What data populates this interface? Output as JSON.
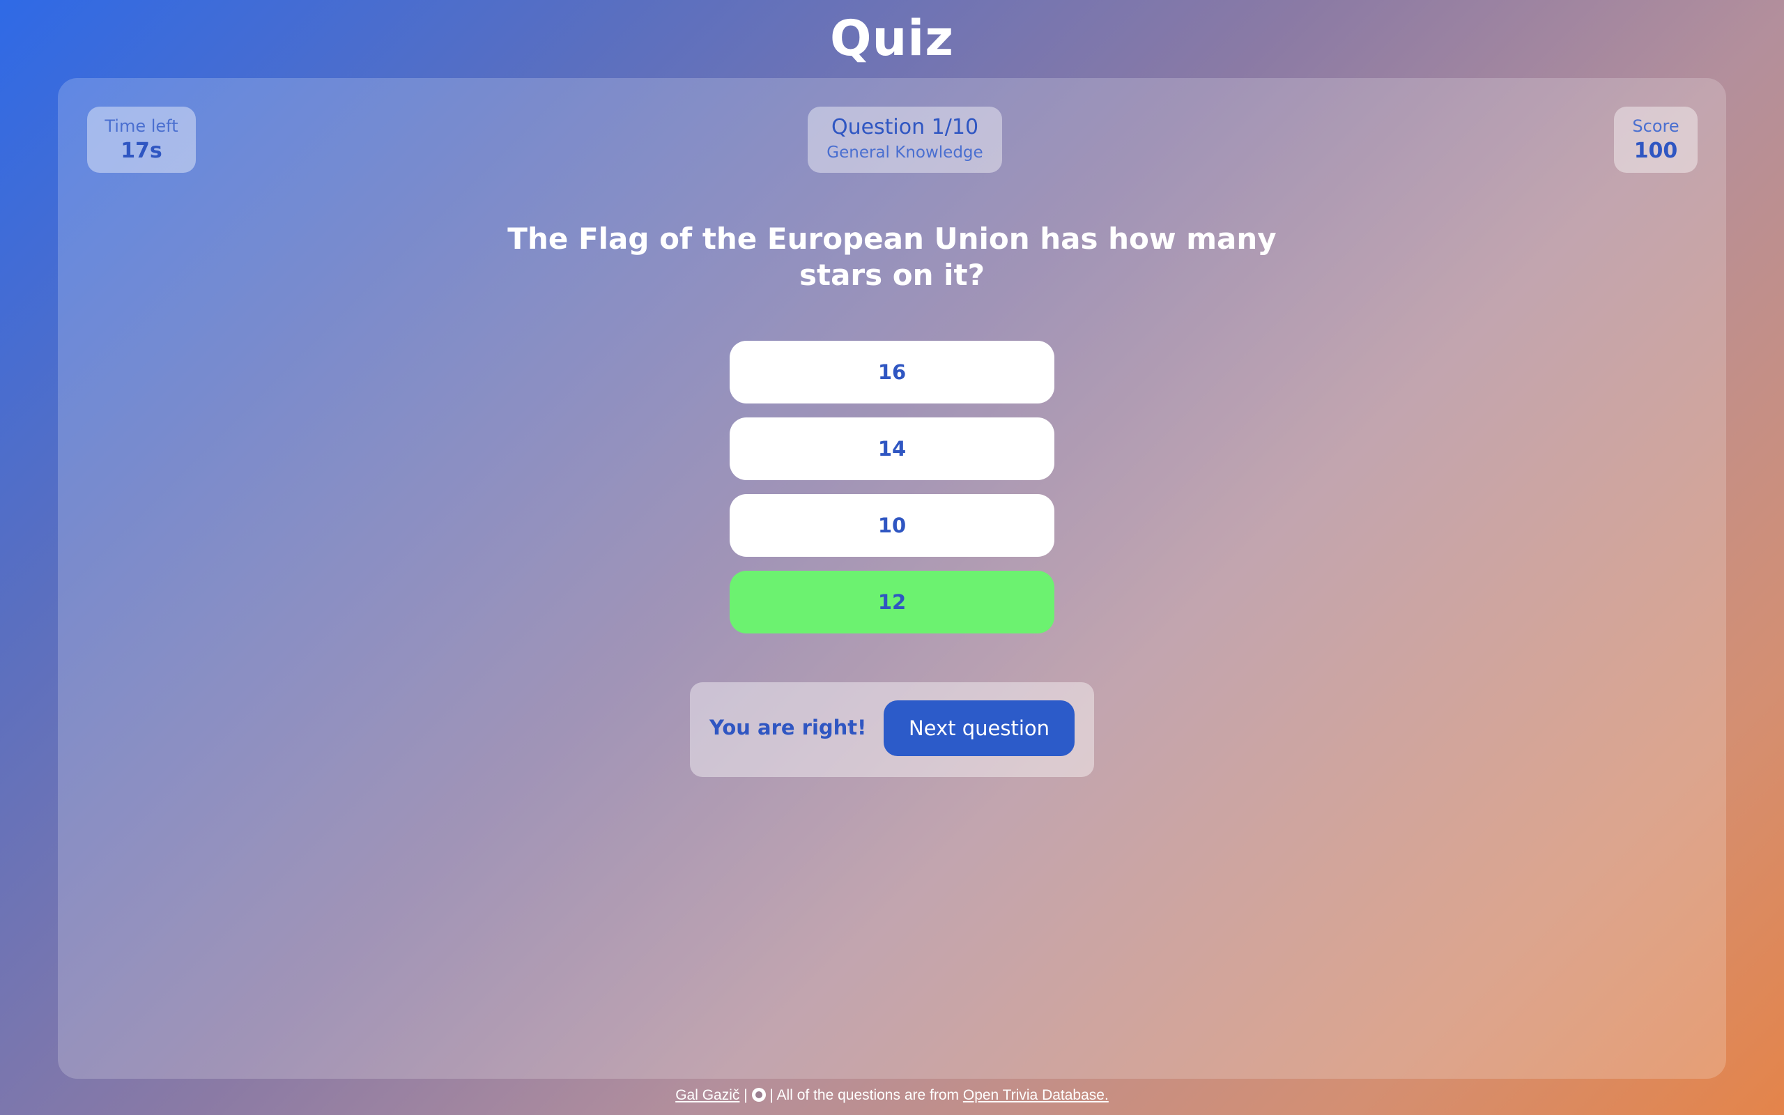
{
  "app": {
    "title": "Quiz"
  },
  "stats": {
    "time_label": "Time left",
    "time_value": "17s",
    "question_label": "Question 1/10",
    "category": "General Knowledge",
    "score_label": "Score",
    "score_value": "100"
  },
  "question": {
    "text": "The Flag of the European Union has how many stars on it?"
  },
  "answers": [
    {
      "label": "16",
      "state": "default"
    },
    {
      "label": "14",
      "state": "default"
    },
    {
      "label": "10",
      "state": "default"
    },
    {
      "label": "12",
      "state": "correct"
    }
  ],
  "result": {
    "message": "You are right!",
    "next_label": "Next question"
  },
  "footer": {
    "author": "Gal Gazič",
    "separator": "|",
    "icon": "github-icon",
    "credit_prefix": "All of the questions are from",
    "source_link": "Open Trivia Database."
  },
  "colors": {
    "accent": "#2c5bc9",
    "correct": "#6cf270",
    "text_on_dark": "#ffffff"
  }
}
